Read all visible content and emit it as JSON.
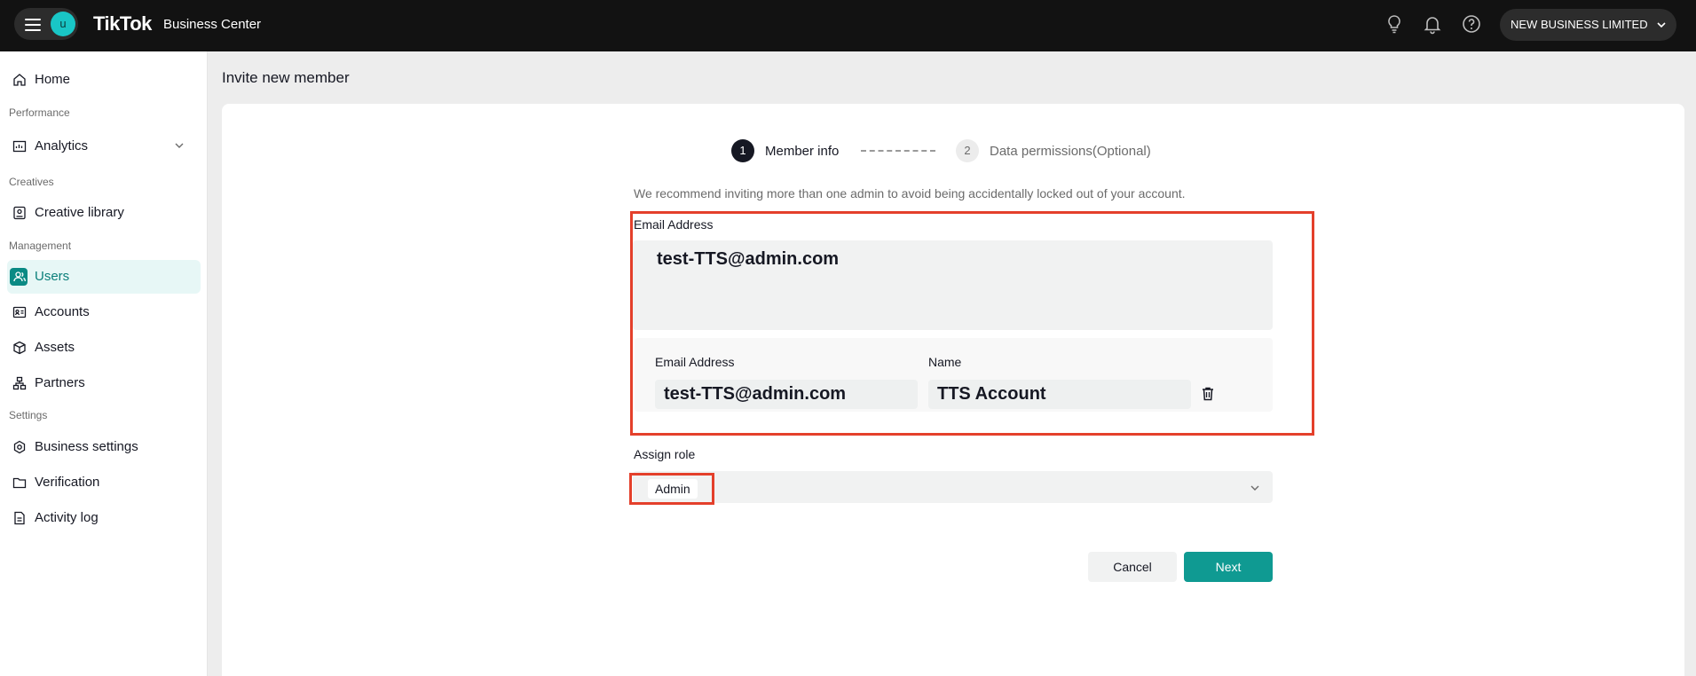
{
  "topbar": {
    "avatar_initial": "u",
    "logo": "TikTok",
    "logo_sub": "Business Center",
    "business_name": "NEW BUSINESS LIMITED"
  },
  "sidebar": {
    "home": "Home",
    "section_performance": "Performance",
    "analytics": "Analytics",
    "section_creatives": "Creatives",
    "creative_library": "Creative library",
    "section_management": "Management",
    "users": "Users",
    "accounts": "Accounts",
    "assets": "Assets",
    "partners": "Partners",
    "section_settings": "Settings",
    "business_settings": "Business settings",
    "verification": "Verification",
    "activity_log": "Activity log"
  },
  "page": {
    "title": "Invite new member",
    "steps": [
      {
        "num": "1",
        "label": "Member info"
      },
      {
        "num": "2",
        "label": "Data permissions(Optional)"
      }
    ],
    "hint": "We recommend inviting more than one admin to avoid being accidentally locked out of your account.",
    "email_label": "Email Address",
    "email_value": "test-TTS@admin.com",
    "row_email_label": "Email Address",
    "row_name_label": "Name",
    "row_email_value": "test-TTS@admin.com",
    "row_name_value": "TTS Account",
    "assign_role_label": "Assign role",
    "role_value": "Admin",
    "cancel": "Cancel",
    "next": "Next"
  },
  "colors": {
    "accent": "#0f9a92",
    "highlight": "#e4402b"
  }
}
